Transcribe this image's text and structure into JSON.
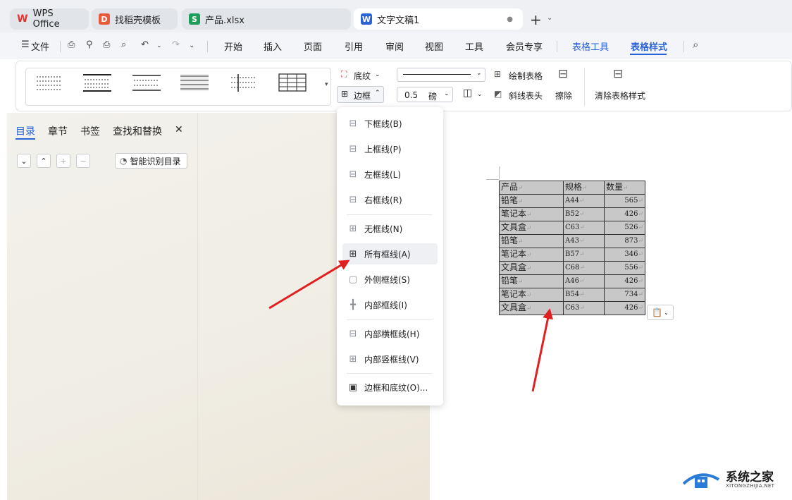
{
  "tabs": [
    {
      "label": "WPS Office",
      "icon": "wps-logo-icon",
      "color": "#e5322d"
    },
    {
      "label": "找稻壳模板",
      "icon": "docer-icon",
      "color": "#e85a3a"
    },
    {
      "label": "产品.xlsx",
      "icon": "spreadsheet-icon",
      "color": "#1e9c5a"
    },
    {
      "label": "文字文稿1",
      "icon": "writer-icon",
      "color": "#2a63d8"
    }
  ],
  "menu": {
    "file": "文件",
    "items": [
      "开始",
      "插入",
      "页面",
      "引用",
      "审阅",
      "视图",
      "工具",
      "会员专享"
    ],
    "table_tools": "表格工具",
    "table_style": "表格样式"
  },
  "ribbon": {
    "shading": "底纹",
    "border": "边框",
    "line_width": "0.5",
    "line_unit": "磅",
    "draw_table": "绘制表格",
    "diagonal_header": "斜线表头",
    "erase": "擦除",
    "clear_style": "清除表格样式"
  },
  "nav": {
    "tabs": [
      "目录",
      "章节",
      "书签",
      "查找和替换"
    ],
    "smart_toc": "智能识别目录"
  },
  "dropdown": {
    "items": [
      "下框线(B)",
      "上框线(P)",
      "左框线(L)",
      "右框线(R)",
      "无框线(N)",
      "所有框线(A)",
      "外侧框线(S)",
      "内部框线(I)",
      "内部横框线(H)",
      "内部竖框线(V)",
      "边框和底纹(O)..."
    ]
  },
  "table": {
    "header": [
      "产品",
      "规格",
      "数量"
    ],
    "rows": [
      [
        "铅笔",
        "A44",
        "565"
      ],
      [
        "笔记本",
        "B52",
        "426"
      ],
      [
        "文具盒",
        "C63",
        "526"
      ],
      [
        "铅笔",
        "A43",
        "873"
      ],
      [
        "笔记本",
        "B57",
        "346"
      ],
      [
        "文具盒",
        "C68",
        "556"
      ],
      [
        "铅笔",
        "A46",
        "426"
      ],
      [
        "笔记本",
        "B54",
        "734"
      ],
      [
        "文具盒",
        "C63",
        "426"
      ]
    ]
  },
  "watermark": {
    "title": "系统之家",
    "url": "XITONGZHIJIA.NET"
  },
  "colors": {
    "accent": "#2a63d8",
    "arrow": "#e02020"
  }
}
